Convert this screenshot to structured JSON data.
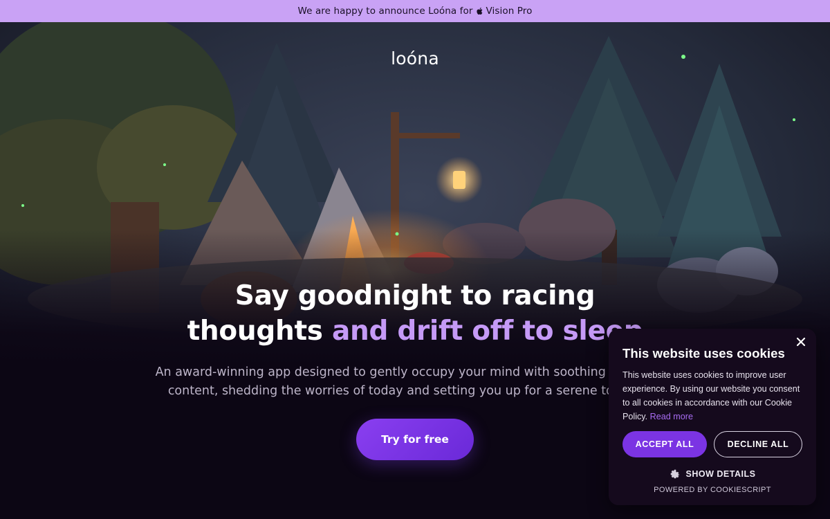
{
  "announcement": {
    "prefix": "We are happy to announce Loóna for",
    "apple_icon": "apple-icon",
    "suffix": "Vision Pro"
  },
  "brand": {
    "logo_text": "loóna"
  },
  "hero": {
    "headline_line1": "Say goodnight to racing",
    "headline_line2_plain": "thoughts",
    "headline_line2_accent": "and drift off to sleep",
    "subtext": "An award-winning app designed to gently occupy your mind with soothing interactive content, shedding the worries of today and setting you up for a serene tomorrow.",
    "cta_label": "Try for free",
    "background": "night-campsite-illustration"
  },
  "cookie_banner": {
    "title": "This website uses cookies",
    "body": "This website uses cookies to improve user experience. By using our website you consent to all cookies in accordance with our Cookie Policy.",
    "read_more": "Read more",
    "accept_label": "ACCEPT ALL",
    "decline_label": "DECLINE ALL",
    "details_label": "SHOW DETAILS",
    "powered_by": "POWERED BY COOKIESCRIPT",
    "close_icon": "close-icon",
    "details_icon": "gear-icon"
  },
  "colors": {
    "announcement_bg": "#c9a2f5",
    "page_bg": "#0c0614",
    "accent_text": "#c59af6",
    "cta_bg": "#7a34e6",
    "cookie_bg": "#150a1d",
    "cookie_accept_bg": "#7b34e3",
    "cookie_link": "#a86cf2"
  }
}
